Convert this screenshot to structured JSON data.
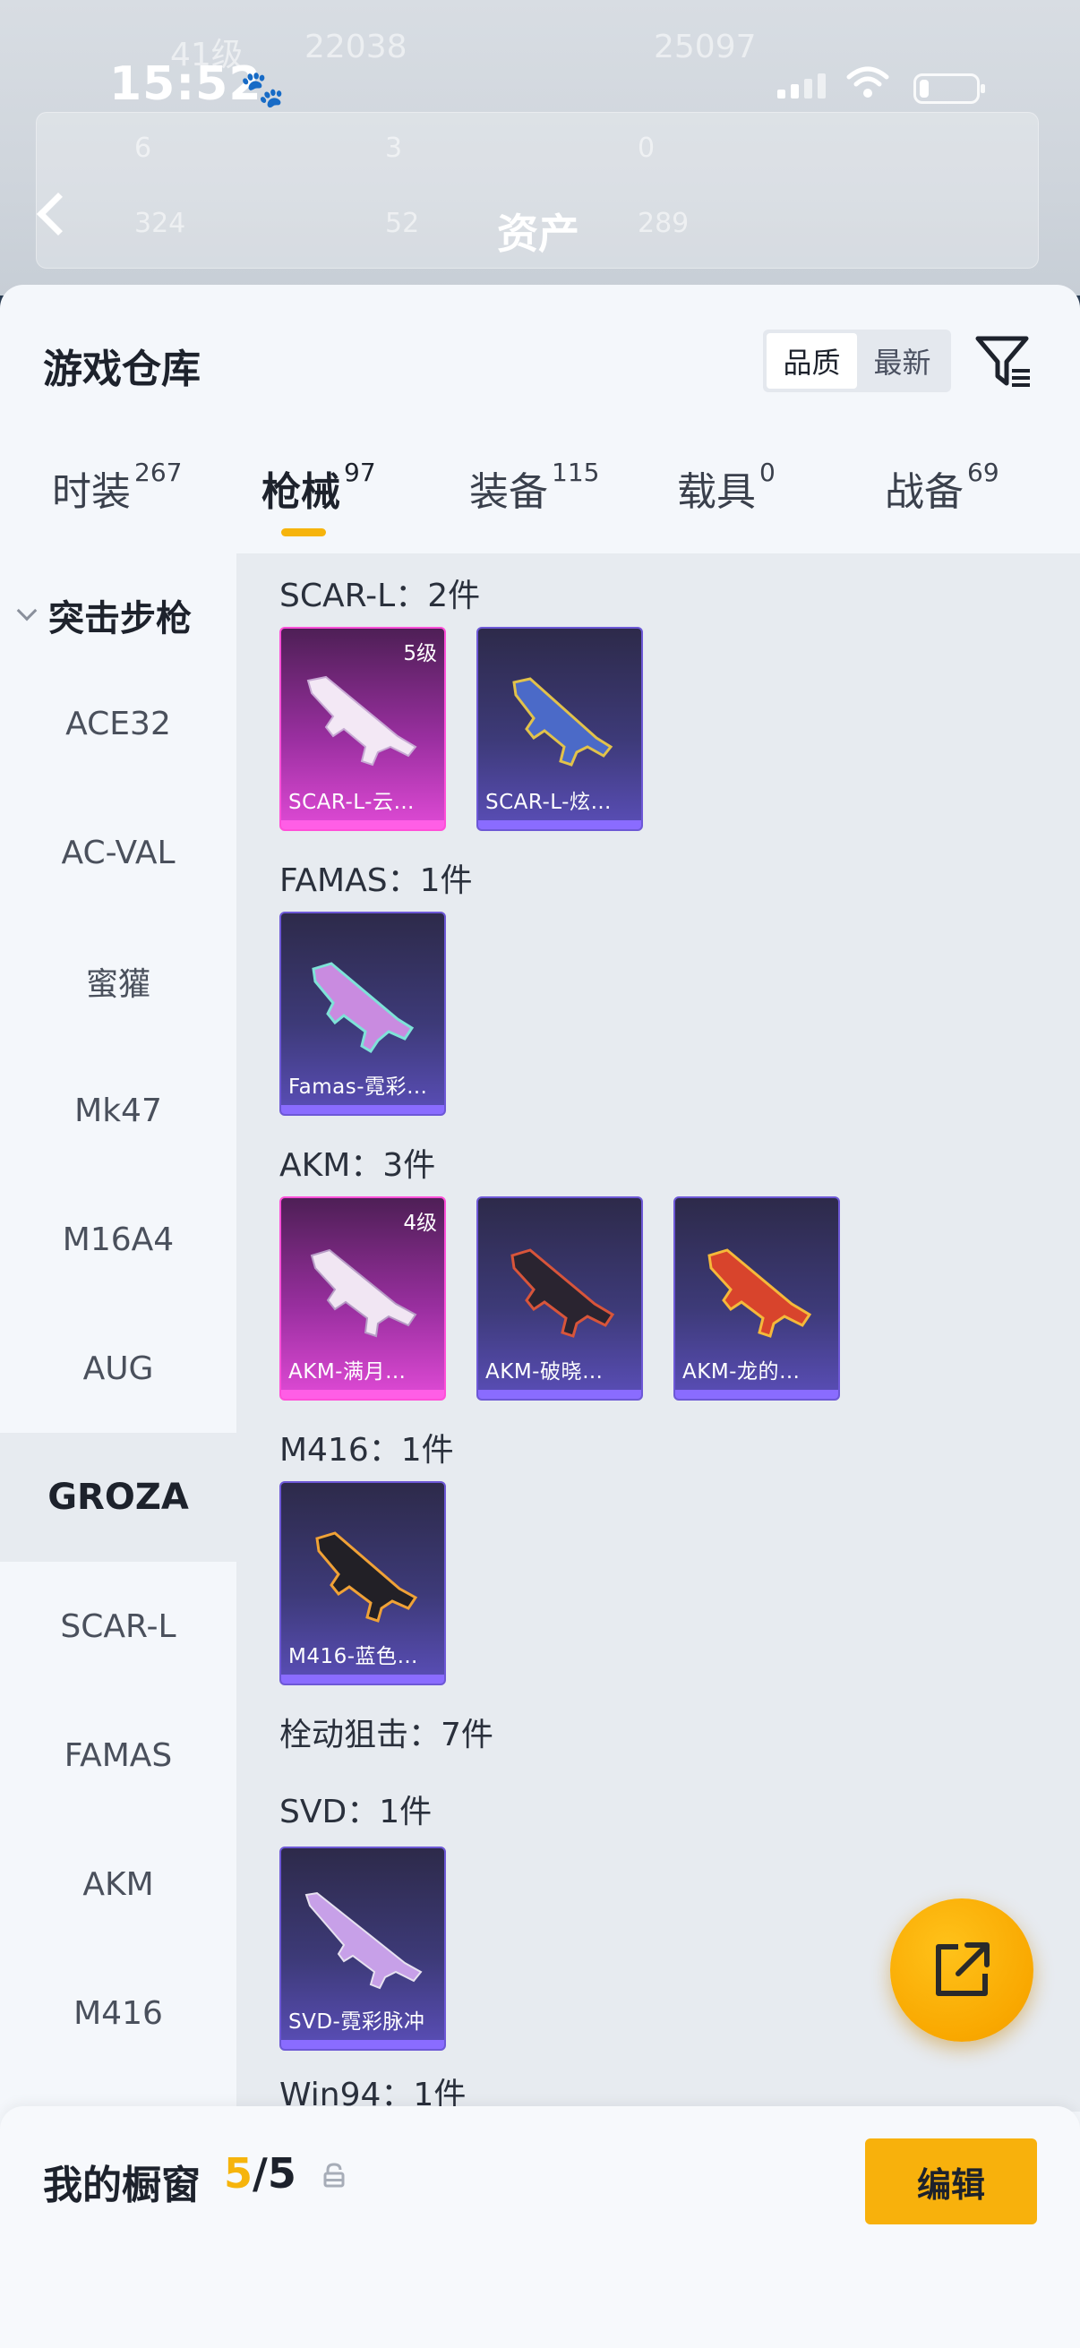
{
  "status": {
    "time": "15:52"
  },
  "background": {
    "page_title": "资产",
    "ghost_texts": [
      "41级",
      "22038",
      "25097",
      "6",
      "3",
      "0",
      "324",
      "52",
      "289"
    ]
  },
  "sheet": {
    "title": "游戏仓库",
    "sort_options": [
      {
        "label": "品质",
        "active": true
      },
      {
        "label": "最新",
        "active": false
      }
    ]
  },
  "tabs": [
    {
      "label": "时装",
      "count": "267",
      "active": false
    },
    {
      "label": "枪械",
      "count": "97",
      "active": true
    },
    {
      "label": "装备",
      "count": "115",
      "active": false
    },
    {
      "label": "载具",
      "count": "0",
      "active": false
    },
    {
      "label": "战备",
      "count": "69",
      "active": false
    }
  ],
  "sidebar": {
    "group": "突击步枪",
    "items": [
      {
        "label": "ACE32",
        "active": false
      },
      {
        "label": "AC-VAL",
        "active": false
      },
      {
        "label": "蜜獾",
        "active": false
      },
      {
        "label": "Mk47",
        "active": false
      },
      {
        "label": "M16A4",
        "active": false
      },
      {
        "label": "AUG",
        "active": false
      },
      {
        "label": "GROZA",
        "active": true
      },
      {
        "label": "SCAR-L",
        "active": false
      },
      {
        "label": "FAMAS",
        "active": false
      },
      {
        "label": "AKM",
        "active": false
      },
      {
        "label": "M416",
        "active": false
      }
    ]
  },
  "groups": [
    {
      "label": "SCAR-L：2件",
      "items": [
        {
          "name": "SCAR-L-云…",
          "level": "5级",
          "rarity": "pink"
        },
        {
          "name": "SCAR-L-炫…",
          "level": "",
          "rarity": "purple"
        }
      ]
    },
    {
      "label": "FAMAS：1件",
      "items": [
        {
          "name": "Famas-霓彩…",
          "level": "",
          "rarity": "purple"
        }
      ]
    },
    {
      "label": "AKM：3件",
      "items": [
        {
          "name": "AKM-满月…",
          "level": "4级",
          "rarity": "pink"
        },
        {
          "name": "AKM-破晓…",
          "level": "",
          "rarity": "purple"
        },
        {
          "name": "AKM-龙的…",
          "level": "",
          "rarity": "purple"
        }
      ]
    },
    {
      "label": "M416：1件",
      "items": [
        {
          "name": "M416-蓝色…",
          "level": "",
          "rarity": "purple"
        }
      ]
    },
    {
      "label": "栓动狙击：7件",
      "items": []
    },
    {
      "label": "SVD：1件",
      "items": [
        {
          "name": "SVD-霓彩脉冲",
          "level": "",
          "rarity": "purple"
        }
      ]
    },
    {
      "label": "Win94：1件",
      "items": []
    }
  ],
  "bottom": {
    "label": "我的橱窗",
    "current": "5",
    "separator": "/",
    "total": "5",
    "edit_label": "编辑"
  },
  "colors": {
    "accent": "#f6b40c",
    "legendary": "#ff4fd8",
    "epic": "#6d58d6"
  }
}
